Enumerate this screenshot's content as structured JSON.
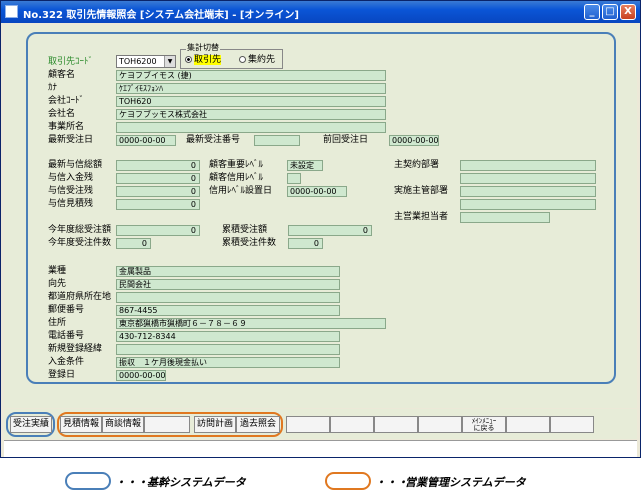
{
  "window": {
    "title": "No.322 取引先情報照会 [システム会社端末] - [オンライン]",
    "min_label": "_",
    "max_label": "□",
    "close_label": "X"
  },
  "header": {
    "torihiki_label": "取引先ｺｰﾄﾞ",
    "torihiki_value": "TOH6200",
    "group_label": "集計切替",
    "radio_torihiki": "取引先",
    "radio_shuyaku": "集約先",
    "kokyakumei_label": "顧客名",
    "kokyakumei_value": "ケヨフブイモス (捷)",
    "kana_label": "ｶﾅ",
    "kana_value": "ｹｴﾌﾞｲﾓｽﾌｮﾝﾊ",
    "kaisha_code_label": "会社ｺｰﾄﾞ",
    "kaisha_code_value": "TOH620",
    "kaisha_mei_label": "会社名",
    "kaisha_mei_value": "ケヨフブッモス株式会社",
    "jigyosho_label": "事業所名",
    "jigyosho_value": "",
    "saishin_juchubi_label": "最新受注日",
    "saishin_juchubi_value": "0000-00-00",
    "saishin_bango_label": "最新受注番号",
    "saishin_bango_value": "",
    "zenkai_label": "前回受注日",
    "zenkai_value": "0000-00-00"
  },
  "credit": {
    "yoshin_sogaku_label": "最新与信総額",
    "yoshin_sogaku_value": "0",
    "yoshin_nyukin_label": "与信入金残",
    "yoshin_nyukin_value": "0",
    "yoshin_juchu_label": "与信受注残",
    "yoshin_juchu_value": "0",
    "yoshin_mitsumori_label": "与信見積残",
    "yoshin_mitsumori_value": "0",
    "juyodo_label": "顧客重要ﾚﾍﾞﾙ",
    "juyodo_value": "未設定",
    "shinyo_label": "顧客信用ﾚﾍﾞﾙ",
    "shinyo_value": "",
    "shinyo_settei_label": "信用ﾚﾍﾞﾙ設置日",
    "shinyo_settei_value": "0000-00-00",
    "shukeiyaku_label": "主契約部署",
    "jisshi_label": "実施主管部署",
    "eigyo_label": "主営業担当者"
  },
  "totals": {
    "nendo_gaku_label": "今年度総受注額",
    "nendo_gaku_value": "0",
    "nendo_ken_label": "今年度受注件数",
    "nendo_ken_value": "0",
    "ruiseki_gaku_label": "累積受注額",
    "ruiseki_gaku_value": "0",
    "ruiseki_ken_label": "累積受注件数",
    "ruiseki_ken_value": "0"
  },
  "info": {
    "gyoshu_label": "業種",
    "gyoshu_value": "金属製品",
    "mukesaki_label": "向先",
    "mukesaki_value": "民間会社",
    "todofuken_label": "都道府県所在地",
    "todofuken_value": "",
    "yubin_label": "郵便番号",
    "yubin_value": "867-4455",
    "jusho_label": "住所",
    "jusho_value": "東京都猟橋市猟橋町６－７８－６９",
    "denwa_label": "電話番号",
    "denwa_value": "430-712-8344",
    "shinki_label": "新規登録経緯",
    "shinki_value": "",
    "nyukin_label": "入金条件",
    "nyukin_value": "振収　１ケ月後現金払い",
    "toroku_label": "登録日",
    "toroku_value": "0000-00-00"
  },
  "fkeys": {
    "f1": "受注実績",
    "f2": "見積情報",
    "f3": "商談情報",
    "f5": "訪問計画",
    "f6": "過去照会",
    "f11": "ﾒｲﾝﾒﾆｭｰ\nに戻る"
  },
  "legend": {
    "blue_dots": "・・・",
    "blue_text": "基幹システムデータ",
    "orange_dots": "・・・",
    "orange_text": "営業管理システムデータ"
  },
  "colors": {
    "blue_outline": "#4a7fb8",
    "orange_outline": "#e07820",
    "field_fill": "#cfe8cf",
    "titlebar": "#0a55d6"
  }
}
